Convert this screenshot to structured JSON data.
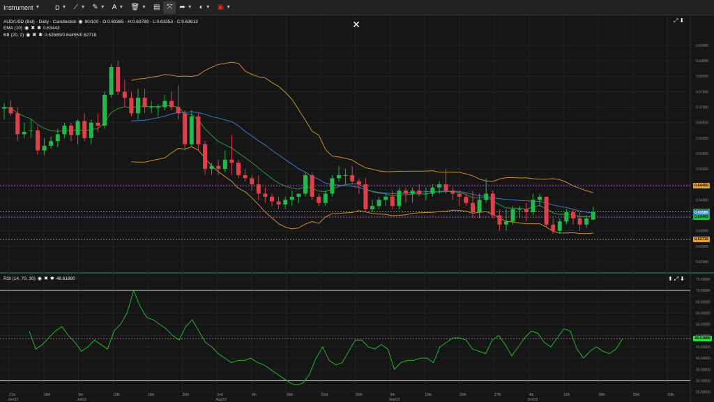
{
  "toolbar": {
    "instrument_label": "Instrument",
    "timeframe_label": "D",
    "icons": [
      "draw-line-icon",
      "pen-icon",
      "text-icon",
      "trash-icon",
      "layout-icon",
      "fullscreen-icon",
      "share-icon",
      "theme-icon",
      "flag-uk-icon"
    ]
  },
  "legend": {
    "main": "AUD/USD (Bid) - Daily - Candlestick",
    "main_values": "90/100 - O:0.63365 - H:0.63789 - L:0.63353 - C:0.63613",
    "ema_name": "EMA (10)",
    "ema_value": "0.63443",
    "bb_name": "BB (20, 2)",
    "bb_value": "0.63585/0.64455/0.62716",
    "rsi_name": "RSI (14, 70, 30)",
    "rsi_value": "48.61880"
  },
  "price_axis": [
    "0.69000",
    "0.68500",
    "0.68000",
    "0.67500",
    "0.67000",
    "0.66500",
    "0.66000",
    "0.65500",
    "0.65000",
    "0.64500",
    "0.64000",
    "0.63500",
    "0.63000",
    "0.62500",
    "0.62000"
  ],
  "price_tags": [
    {
      "label": "0.64455",
      "color": "#e0a030"
    },
    {
      "label": "0.63613",
      "color": "#22b84a"
    },
    {
      "label": "0.63585",
      "color": "#2a7fd0"
    },
    {
      "label": "0.63443",
      "color": "#22b84a"
    },
    {
      "label": "0.62716",
      "color": "#e0a030"
    }
  ],
  "rsi_axis": [
    "75.00000",
    "70.00000",
    "65.00000",
    "60.00000",
    "55.00000",
    "50.00000",
    "45.00000",
    "40.00000",
    "35.00000",
    "30.00000",
    "25.00000"
  ],
  "rsi_tag": {
    "label": "48.61880",
    "color": "#22e040"
  },
  "date_axis": [
    {
      "day": "21st",
      "sub": "Jun/23"
    },
    {
      "day": "28th",
      "sub": ""
    },
    {
      "day": "5th",
      "sub": "Jul/23"
    },
    {
      "day": "12th",
      "sub": ""
    },
    {
      "day": "19th",
      "sub": ""
    },
    {
      "day": "26th",
      "sub": ""
    },
    {
      "day": "2nd",
      "sub": "Aug/23"
    },
    {
      "day": "9th",
      "sub": ""
    },
    {
      "day": "16th",
      "sub": ""
    },
    {
      "day": "23rd",
      "sub": ""
    },
    {
      "day": "30th",
      "sub": ""
    },
    {
      "day": "6th",
      "sub": "Sep/23"
    },
    {
      "day": "13th",
      "sub": ""
    },
    {
      "day": "20th",
      "sub": ""
    },
    {
      "day": "27th",
      "sub": ""
    },
    {
      "day": "4th",
      "sub": "Oct/23"
    },
    {
      "day": "11th",
      "sub": ""
    },
    {
      "day": "18th",
      "sub": ""
    },
    {
      "day": "25th",
      "sub": ""
    },
    {
      "day": "30th",
      "sub": ""
    }
  ],
  "chart_data": {
    "type": "candlestick",
    "ohlc": [
      [
        0.6695,
        0.6712,
        0.666,
        0.67
      ],
      [
        0.67,
        0.6722,
        0.6672,
        0.668
      ],
      [
        0.668,
        0.67,
        0.659,
        0.6612
      ],
      [
        0.6612,
        0.665,
        0.66,
        0.662
      ],
      [
        0.6625,
        0.666,
        0.66,
        0.6625
      ],
      [
        0.6625,
        0.664,
        0.6545,
        0.656
      ],
      [
        0.656,
        0.66,
        0.6545,
        0.6575
      ],
      [
        0.6575,
        0.6605,
        0.6565,
        0.659
      ],
      [
        0.659,
        0.663,
        0.657,
        0.6612
      ],
      [
        0.6612,
        0.665,
        0.66,
        0.664
      ],
      [
        0.664,
        0.665,
        0.659,
        0.661
      ],
      [
        0.661,
        0.666,
        0.658,
        0.6655
      ],
      [
        0.6655,
        0.668,
        0.659,
        0.66
      ],
      [
        0.66,
        0.666,
        0.658,
        0.665
      ],
      [
        0.665,
        0.668,
        0.662,
        0.664
      ],
      [
        0.664,
        0.675,
        0.663,
        0.674
      ],
      [
        0.674,
        0.684,
        0.673,
        0.683
      ],
      [
        0.683,
        0.685,
        0.674,
        0.675
      ],
      [
        0.675,
        0.679,
        0.67,
        0.673
      ],
      [
        0.673,
        0.675,
        0.667,
        0.668
      ],
      [
        0.668,
        0.676,
        0.666,
        0.673
      ],
      [
        0.673,
        0.676,
        0.668,
        0.67
      ],
      [
        0.67,
        0.672,
        0.668,
        0.67
      ],
      [
        0.67,
        0.671,
        0.667,
        0.67
      ],
      [
        0.67,
        0.674,
        0.669,
        0.672
      ],
      [
        0.672,
        0.675,
        0.669,
        0.67
      ],
      [
        0.67,
        0.677,
        0.666,
        0.668
      ],
      [
        0.668,
        0.669,
        0.656,
        0.658
      ],
      [
        0.658,
        0.669,
        0.657,
        0.667
      ],
      [
        0.667,
        0.668,
        0.656,
        0.658
      ],
      [
        0.658,
        0.659,
        0.648,
        0.65
      ],
      [
        0.65,
        0.652,
        0.648,
        0.651
      ],
      [
        0.651,
        0.653,
        0.648,
        0.65
      ],
      [
        0.65,
        0.656,
        0.649,
        0.653
      ],
      [
        0.653,
        0.661,
        0.648,
        0.652
      ],
      [
        0.652,
        0.653,
        0.647,
        0.648
      ],
      [
        0.648,
        0.65,
        0.646,
        0.647
      ],
      [
        0.647,
        0.648,
        0.643,
        0.645
      ],
      [
        0.645,
        0.648,
        0.64,
        0.642
      ],
      [
        0.642,
        0.644,
        0.639,
        0.641
      ],
      [
        0.641,
        0.642,
        0.638,
        0.6395
      ],
      [
        0.6395,
        0.641,
        0.637,
        0.6385
      ],
      [
        0.6385,
        0.641,
        0.637,
        0.64
      ],
      [
        0.64,
        0.643,
        0.638,
        0.641
      ],
      [
        0.641,
        0.642,
        0.639,
        0.642
      ],
      [
        0.642,
        0.649,
        0.641,
        0.648
      ],
      [
        0.648,
        0.649,
        0.64,
        0.641
      ],
      [
        0.641,
        0.642,
        0.638,
        0.639
      ],
      [
        0.639,
        0.643,
        0.638,
        0.642
      ],
      [
        0.642,
        0.648,
        0.641,
        0.647
      ],
      [
        0.647,
        0.651,
        0.646,
        0.648
      ],
      [
        0.648,
        0.65,
        0.645,
        0.648
      ],
      [
        0.648,
        0.651,
        0.645,
        0.646
      ],
      [
        0.646,
        0.647,
        0.642,
        0.645
      ],
      [
        0.645,
        0.647,
        0.636,
        0.637
      ],
      [
        0.637,
        0.64,
        0.636,
        0.638
      ],
      [
        0.638,
        0.641,
        0.637,
        0.64
      ],
      [
        0.64,
        0.642,
        0.638,
        0.641
      ],
      [
        0.641,
        0.643,
        0.637,
        0.638
      ],
      [
        0.638,
        0.644,
        0.637,
        0.643
      ],
      [
        0.643,
        0.644,
        0.639,
        0.642
      ],
      [
        0.642,
        0.644,
        0.639,
        0.643
      ],
      [
        0.643,
        0.645,
        0.641,
        0.642
      ],
      [
        0.642,
        0.644,
        0.64,
        0.642
      ],
      [
        0.642,
        0.645,
        0.641,
        0.644
      ],
      [
        0.644,
        0.646,
        0.642,
        0.645
      ],
      [
        0.645,
        0.65,
        0.642,
        0.643
      ],
      [
        0.643,
        0.644,
        0.64,
        0.642
      ],
      [
        0.642,
        0.643,
        0.638,
        0.641
      ],
      [
        0.641,
        0.642,
        0.638,
        0.639
      ],
      [
        0.639,
        0.643,
        0.634,
        0.636
      ],
      [
        0.636,
        0.642,
        0.634,
        0.64
      ],
      [
        0.64,
        0.647,
        0.639,
        0.642
      ],
      [
        0.642,
        0.643,
        0.634,
        0.635
      ],
      [
        0.635,
        0.637,
        0.63,
        0.632
      ],
      [
        0.632,
        0.637,
        0.63,
        0.633
      ],
      [
        0.633,
        0.638,
        0.632,
        0.637
      ],
      [
        0.637,
        0.638,
        0.634,
        0.637
      ],
      [
        0.637,
        0.639,
        0.633,
        0.636
      ],
      [
        0.636,
        0.642,
        0.635,
        0.64
      ],
      [
        0.64,
        0.642,
        0.638,
        0.641
      ],
      [
        0.641,
        0.641,
        0.631,
        0.632
      ],
      [
        0.632,
        0.634,
        0.629,
        0.63
      ],
      [
        0.63,
        0.634,
        0.629,
        0.633
      ],
      [
        0.633,
        0.637,
        0.632,
        0.636
      ],
      [
        0.636,
        0.637,
        0.632,
        0.634
      ],
      [
        0.634,
        0.636,
        0.63,
        0.632
      ],
      [
        0.632,
        0.635,
        0.631,
        0.634
      ],
      [
        0.6336,
        0.6379,
        0.6335,
        0.6361
      ]
    ],
    "rsi": [
      52,
      44,
      46,
      49,
      52,
      54,
      50,
      47,
      43,
      45,
      48,
      46,
      44,
      52,
      55,
      60,
      70,
      63,
      58,
      57,
      55,
      53,
      50,
      48,
      54,
      57,
      52,
      47,
      45,
      42,
      40,
      38,
      39,
      39,
      40,
      38,
      37,
      35,
      33,
      31,
      29,
      28,
      29,
      33,
      40,
      45,
      39,
      37,
      38,
      43,
      48,
      48,
      45,
      44,
      46,
      44,
      35,
      38,
      39,
      39,
      40,
      40,
      38,
      45,
      47,
      49,
      49,
      48,
      44,
      43,
      42,
      48,
      50,
      46,
      41,
      45,
      49,
      52,
      51,
      47,
      45,
      49,
      53,
      52,
      44,
      40,
      43,
      45,
      43,
      42,
      44,
      48.6
    ],
    "ema": [],
    "bb_upper": [],
    "bb_lower": [],
    "hlines": [
      0.64455,
      0.63613,
      0.63443,
      0.62716
    ],
    "rsi_levels": [
      70,
      30
    ],
    "rsi_hline": 48.6188,
    "price_range": [
      0.6175,
      0.6945
    ],
    "rsi_range": [
      25.5,
      75
    ],
    "colors": {
      "up": "#22b84a",
      "down": "#e0404a",
      "ema": "#2a9a3a",
      "bb_mid": "#3a78c8",
      "bb_band": "#c89030",
      "rsi": "#22b822",
      "hline": "#b45ad0"
    }
  }
}
